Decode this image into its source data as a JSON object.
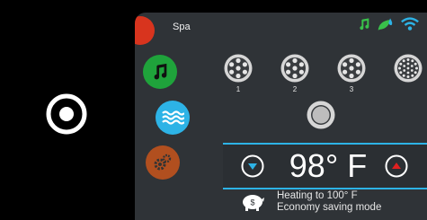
{
  "header": {
    "title": "Spa"
  },
  "status": {
    "icons": [
      "music-note-icon",
      "leaf-drop-icon",
      "wifi-icon"
    ]
  },
  "nav": {
    "items": [
      "spa-icon",
      "music-icon",
      "waves-icon",
      "settings-icon"
    ]
  },
  "jets": {
    "labels": [
      "1",
      "2",
      "3"
    ]
  },
  "temperature": {
    "value": "98° F"
  },
  "status_text": {
    "line1": "Heating to 100° F",
    "line2": "Economy saving mode"
  },
  "colors": {
    "accent": "#2db3e6",
    "background": "#2f3337",
    "music": "#1fa33b",
    "spa": "#d8341e",
    "settings": "#b14f1f",
    "up_arrow": "#e02020"
  }
}
